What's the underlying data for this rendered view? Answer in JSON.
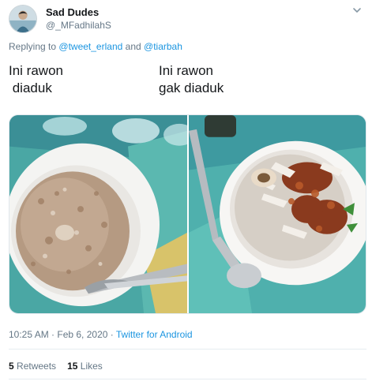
{
  "tweet": {
    "author": {
      "display_name": "Sad Dudes",
      "handle": "@_MFadhilahS"
    },
    "reply": {
      "prefix": "Replying to",
      "mention_1": "@tweet_erland",
      "conjunction": "and",
      "mention_2": "@tiarbah"
    },
    "text_left": "Ini rawon\n diaduk",
    "text_right": "Ini rawon\ngak diaduk",
    "timestamp": "10:25 AM · Feb 6, 2020",
    "separator": "·",
    "source": "Twitter for Android",
    "retweets": {
      "count": "5",
      "label": "Retweets"
    },
    "likes": {
      "count": "15",
      "label": "Likes"
    }
  },
  "colors": {
    "link": "#1b95e0",
    "secondary_text": "#657786",
    "primary_text": "#14171a",
    "divider": "#e6ecf0"
  },
  "icons": {
    "caret": "chevron-down-icon",
    "avatar": "avatar"
  }
}
